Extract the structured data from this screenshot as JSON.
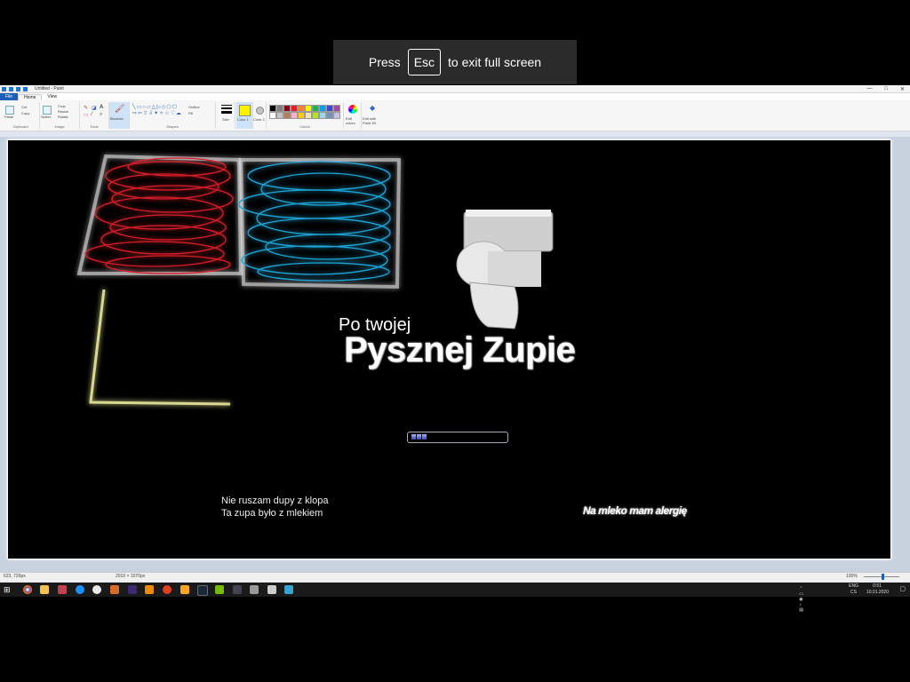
{
  "fullscreen_toast": {
    "press": "Press",
    "key": "Esc",
    "message": "to exit full screen"
  },
  "window": {
    "title": "Untitled - Paint",
    "controls": [
      "—",
      "□",
      "✕"
    ]
  },
  "tabs": {
    "file": "File",
    "home": "Home",
    "view": "View"
  },
  "ribbon": {
    "clipboard": {
      "paste": "Paste",
      "cut": "Cut",
      "copy": "Copy",
      "label": "Clipboard"
    },
    "image": {
      "select": "Select",
      "crop": "Crop",
      "resize": "Resize",
      "rotate": "Rotate",
      "label": "Image"
    },
    "tools": {
      "label": "Tools"
    },
    "brushes": {
      "label": "Brushes"
    },
    "shapes": {
      "outline": "Outline",
      "fill": "Fill",
      "label": "Shapes"
    },
    "size": {
      "label": "Size"
    },
    "color1": {
      "label": "Color 1"
    },
    "color2": {
      "label": "Color 2"
    },
    "colors": {
      "label": "Colors"
    },
    "edit_colors": {
      "label": "Edit colors"
    },
    "paint3d": {
      "label": "Edit with Paint 3D"
    },
    "palette": [
      "#000000",
      "#7f7f7f",
      "#880015",
      "#ed1c24",
      "#ff7f27",
      "#fff200",
      "#22b14c",
      "#00a2e8",
      "#3f48cc",
      "#a349a4",
      "#ffffff",
      "#c3c3c3",
      "#b97a57",
      "#ffaec9",
      "#ffc90e",
      "#efe4b0",
      "#b5e61d",
      "#99d9ea",
      "#7092be",
      "#c8bfe7"
    ]
  },
  "canvas": {
    "heading_small": "Po twojej",
    "heading_big": "Pysznej Zupie",
    "left_line1": "Nie ruszam dupy z klopa",
    "left_line2": "Ta zupa było z mlekiem",
    "right_text": "Na mleko mam alergię",
    "loader_progress": 0.15
  },
  "statusbar": {
    "position": "623, 729px",
    "dimensions": "2010 × 1070px",
    "zoom": "100%"
  },
  "taskbar": {
    "clock_time": "0:51",
    "clock_date": "10.01.2020",
    "lang": "ENG",
    "lang2": "CS"
  },
  "colors": {
    "accent": "#1c5eb8",
    "red_scribble": "#d81e2a",
    "blue_scribble": "#1ea6d8",
    "yellow_line": "#d8d890"
  }
}
